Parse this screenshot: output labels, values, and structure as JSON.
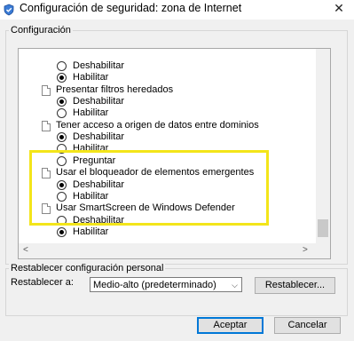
{
  "window": {
    "title": "Configuración de seguridad: zona de Internet",
    "close_glyph": "✕"
  },
  "settings_group": {
    "label": "Configuración",
    "rows": [
      {
        "kind": "radio",
        "label": "Deshabilitar",
        "checked": false
      },
      {
        "kind": "radio",
        "label": "Habilitar",
        "checked": true
      },
      {
        "kind": "setting",
        "label": "Presentar filtros heredados"
      },
      {
        "kind": "radio",
        "label": "Deshabilitar",
        "checked": true
      },
      {
        "kind": "radio",
        "label": "Habilitar",
        "checked": false
      },
      {
        "kind": "setting",
        "label": "Tener acceso a origen de datos entre dominios"
      },
      {
        "kind": "radio",
        "label": "Deshabilitar",
        "checked": true
      },
      {
        "kind": "radio",
        "label": "Habilitar",
        "checked": false
      },
      {
        "kind": "radio",
        "label": "Preguntar",
        "checked": false
      },
      {
        "kind": "setting",
        "label": "Usar el bloqueador de elementos emergentes"
      },
      {
        "kind": "radio",
        "label": "Deshabilitar",
        "checked": true
      },
      {
        "kind": "radio",
        "label": "Habilitar",
        "checked": false
      },
      {
        "kind": "setting",
        "label": "Usar SmartScreen de Windows Defender"
      },
      {
        "kind": "radio",
        "label": "Deshabilitar",
        "checked": false
      },
      {
        "kind": "radio",
        "label": "Habilitar",
        "checked": true
      }
    ],
    "scroll_left_glyph": "<",
    "scroll_right_glyph": ">"
  },
  "reset_group": {
    "label": "Restablecer configuración personal",
    "reset_to_label": "Restablecer a:",
    "selected_level": "Medio-alto (predeterminado)",
    "reset_button": "Restablecer..."
  },
  "footer": {
    "ok_button": "Aceptar",
    "cancel_button": "Cancelar"
  },
  "colors": {
    "highlight": "#f3e51a",
    "default_button_border": "#0078d7"
  }
}
